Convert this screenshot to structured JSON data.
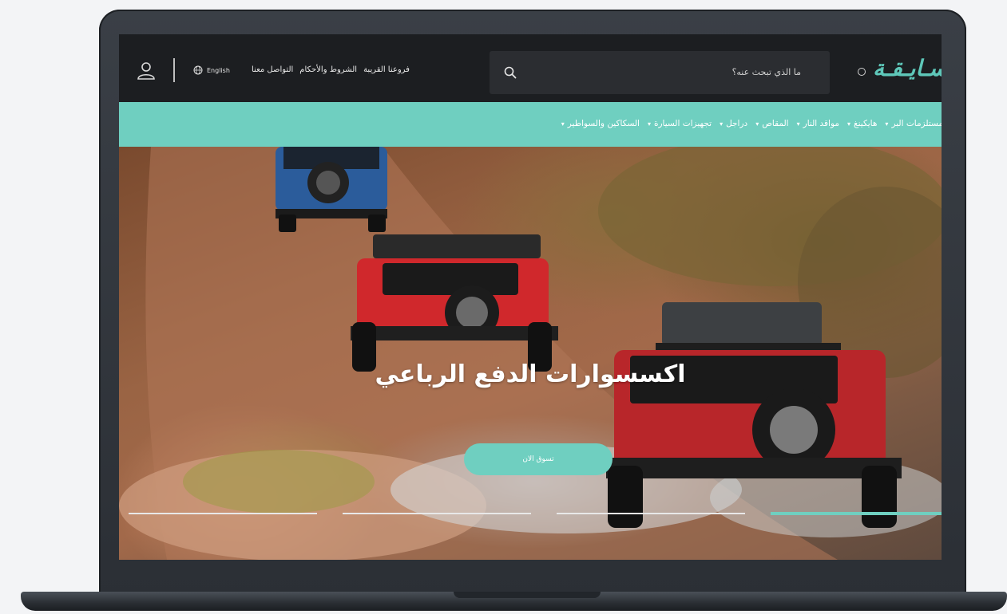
{
  "header": {
    "logo_text": "سـايـقـة",
    "search_placeholder": "ما الذي تبحث عنه؟",
    "links": [
      "فروعنا القريبة",
      "الشروط والأحكام",
      "التواصل معنا"
    ],
    "language": "English"
  },
  "nav": {
    "items": [
      {
        "label": "مستلزمات البر"
      },
      {
        "label": "هايكينغ"
      },
      {
        "label": "مواقد النار"
      },
      {
        "label": "المقاص"
      },
      {
        "label": "دراجل"
      },
      {
        "label": "تجهيزات السيارة"
      },
      {
        "label": "السكاكين والسواطير"
      }
    ]
  },
  "hero": {
    "title": "اكسسوارات الدفع الرباعي",
    "cta_label": "تسوق الان",
    "slides_total": 4,
    "active_slide": 4
  },
  "colors": {
    "accent": "#6fcfc0",
    "header_bg": "#1c1e21",
    "search_bg": "#2b2d31"
  },
  "icons": {
    "user": "user-icon",
    "globe": "globe-icon",
    "search": "search-icon",
    "chevron": "chevron-down-icon"
  }
}
